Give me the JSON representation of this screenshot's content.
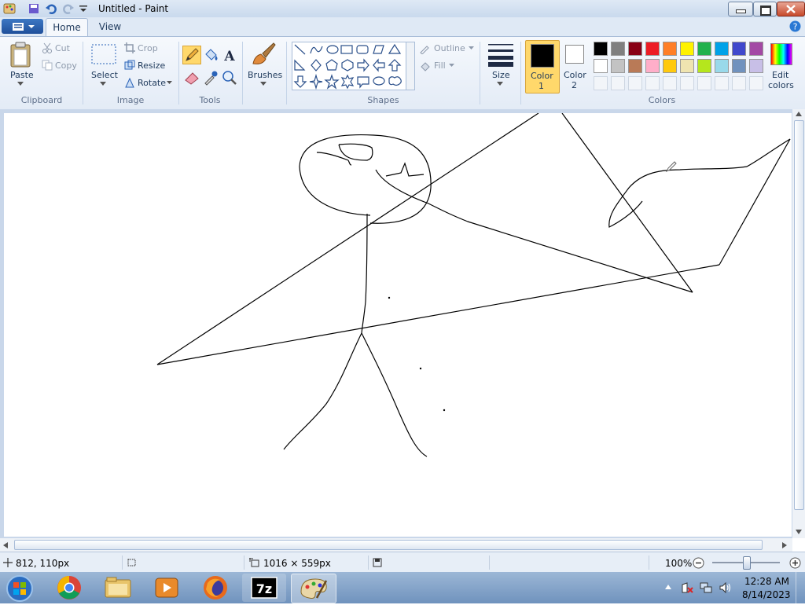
{
  "window": {
    "title": "Untitled - Paint"
  },
  "tabs": {
    "home": "Home",
    "view": "View"
  },
  "ribbon": {
    "clipboard": {
      "label": "Clipboard",
      "paste": "Paste",
      "cut": "Cut",
      "copy": "Copy"
    },
    "image": {
      "label": "Image",
      "select": "Select",
      "crop": "Crop",
      "resize": "Resize",
      "rotate": "Rotate"
    },
    "tools": {
      "label": "Tools"
    },
    "brushes": {
      "label": "Brushes"
    },
    "shapes": {
      "label": "Shapes",
      "outline": "Outline",
      "fill": "Fill"
    },
    "size": {
      "label": "Size"
    },
    "color1": {
      "line1": "Color",
      "line2": "1"
    },
    "color2": {
      "line1": "Color",
      "line2": "2"
    },
    "colors": {
      "label": "Colors",
      "edit_line1": "Edit",
      "edit_line2": "colors",
      "row1": [
        "#000000",
        "#7f7f7f",
        "#880015",
        "#ed1c24",
        "#ff7f27",
        "#fff200",
        "#22b14c",
        "#00a2e8",
        "#3f48cc",
        "#a349a4"
      ],
      "row2": [
        "#ffffff",
        "#c3c3c3",
        "#b97a57",
        "#ffaec9",
        "#ffc90e",
        "#efe4b0",
        "#b5e61d",
        "#99d9ea",
        "#7092be",
        "#c8bfe7"
      ]
    }
  },
  "status": {
    "cursor_pos": "812, 110px",
    "canvas_size": "1016 × 559px",
    "zoom": "100%"
  },
  "taskbar": {
    "apps": [
      "start-orb",
      "chrome",
      "file-explorer",
      "media-player",
      "firefox",
      "7zip",
      "paint"
    ],
    "time": "12:28 AM",
    "date": "8/14/2023"
  }
}
